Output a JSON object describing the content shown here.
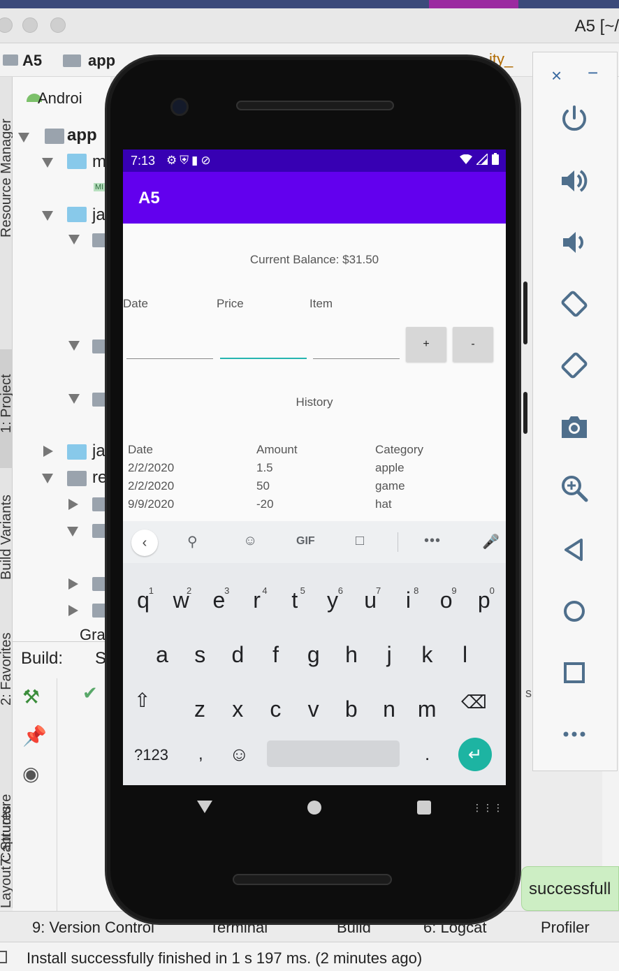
{
  "ide": {
    "window_title": "A5 [~/",
    "breadcrumb": [
      "A5",
      "app"
    ],
    "breadcrumb_tail": "ity_",
    "project_panel_title": "Androi",
    "tree": [
      "app",
      "m",
      "ja",
      "ja",
      "re",
      "Grad"
    ],
    "manifest_badge": "MI",
    "side_tabs": [
      "Resource Manager",
      "1: Project",
      "Build Variants",
      "2: Favorites",
      "7: Structure",
      "Layout Captures"
    ],
    "build_title": "Build:",
    "build_tab_fragment": "S",
    "right_fragment": "s",
    "success_message": "successfull",
    "bottom_tabs": [
      "9: Version Control",
      "Terminal",
      "Build",
      "6: Logcat",
      "Profiler"
    ],
    "status_message": "Install successfully finished in 1 s 197 ms. (2 minutes ago)"
  },
  "emulator": {
    "close_label": "×",
    "minimize_label": "−",
    "buttons": [
      "power-icon",
      "volume-up-icon",
      "volume-down-icon",
      "rotate-left-icon",
      "rotate-right-icon",
      "camera-icon",
      "zoom-icon",
      "back-icon",
      "home-icon",
      "overview-icon",
      "more-icon"
    ]
  },
  "phone": {
    "status_time": "7:13",
    "app_title": "A5",
    "balance_text": "Current Balance: $31.50",
    "input_headers": {
      "date": "Date",
      "price": "Price",
      "item": "Item"
    },
    "inputs": {
      "date": "",
      "price": "",
      "item": ""
    },
    "buttons": {
      "plus": "+",
      "minus": "-"
    },
    "history_title": "History",
    "history_headers": {
      "date": "Date",
      "amount": "Amount",
      "category": "Category"
    },
    "history_rows": [
      {
        "date": "2/2/2020",
        "amount": "1.5",
        "category": "apple"
      },
      {
        "date": "2/2/2020",
        "amount": "50",
        "category": "game"
      },
      {
        "date": "9/9/2020",
        "amount": "-20",
        "category": "hat"
      }
    ],
    "colors": {
      "status_bar": "#3700b3",
      "app_bar": "#6200ee",
      "accent": "#26b5b0",
      "enter_key": "#1db4a2"
    }
  },
  "keyboard": {
    "gif_label": "GIF",
    "more_label": "•••",
    "row1": [
      "q",
      "w",
      "e",
      "r",
      "t",
      "y",
      "u",
      "i",
      "o",
      "p"
    ],
    "row1_hints": [
      "1",
      "2",
      "3",
      "4",
      "5",
      "6",
      "7",
      "8",
      "9",
      "0"
    ],
    "row2": [
      "a",
      "s",
      "d",
      "f",
      "g",
      "h",
      "j",
      "k",
      "l"
    ],
    "row3": [
      "z",
      "x",
      "c",
      "v",
      "b",
      "n",
      "m"
    ],
    "symbols_label": "?123",
    "comma_label": ",",
    "period_label": "."
  }
}
